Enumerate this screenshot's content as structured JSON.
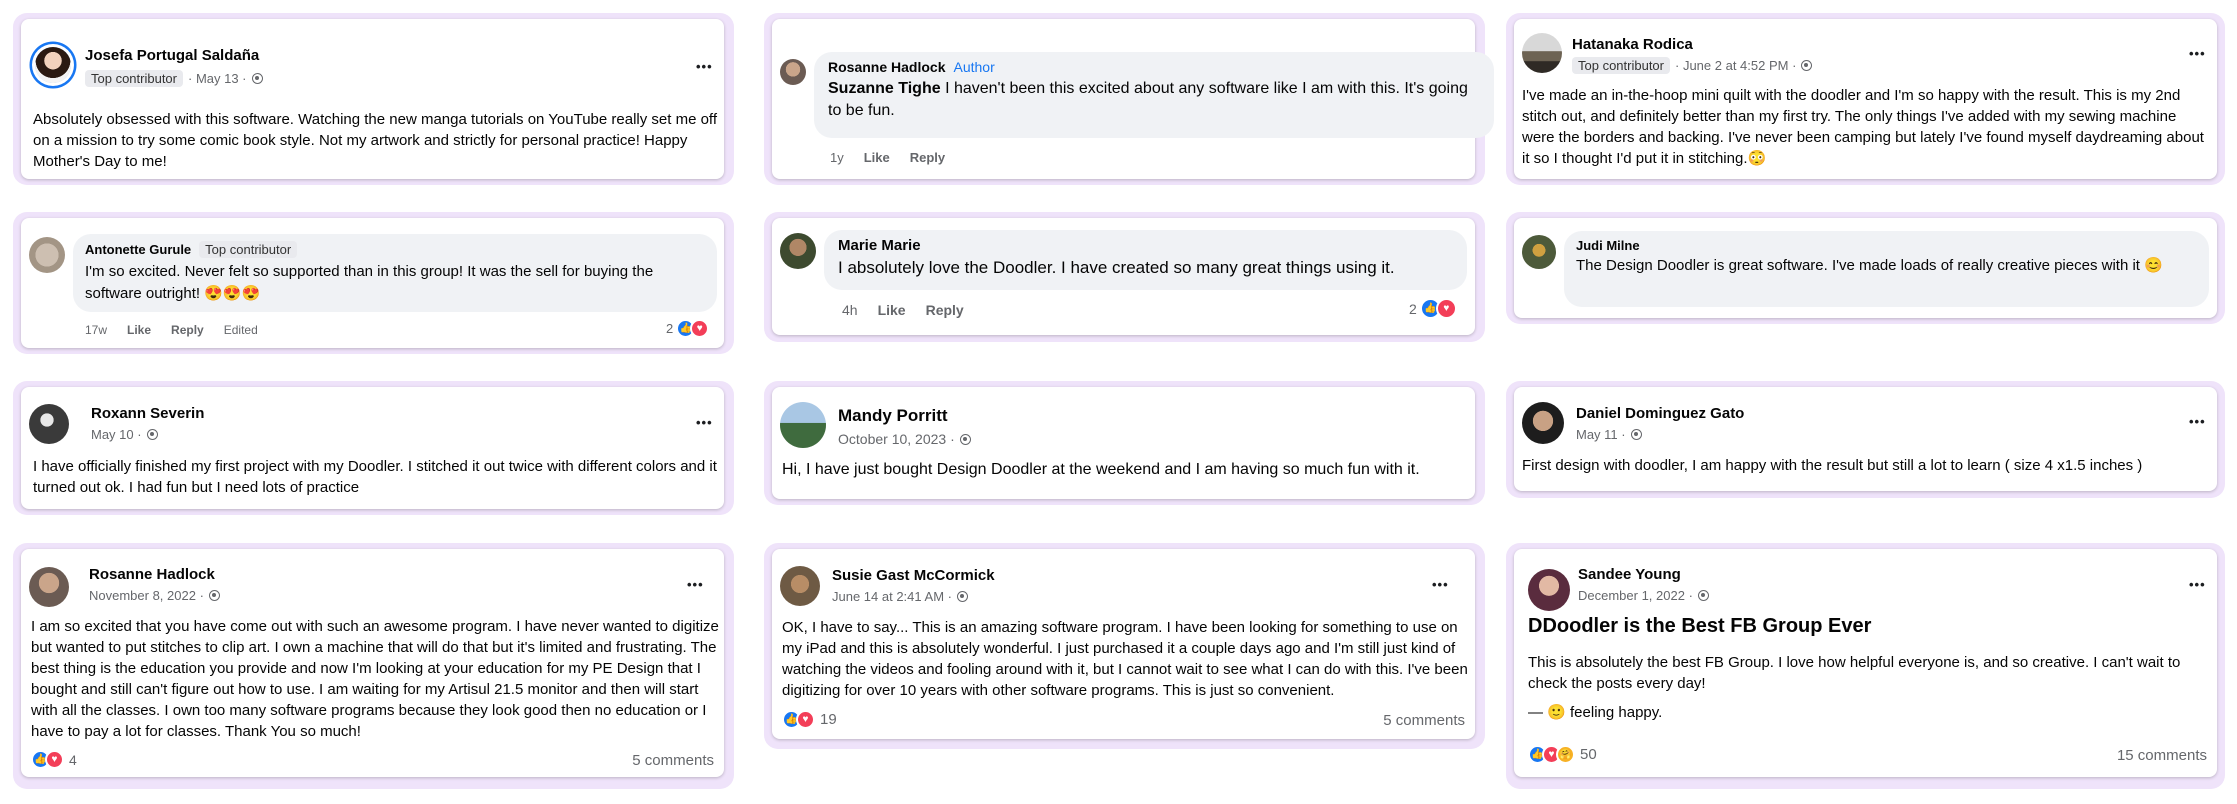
{
  "posts": {
    "p1": {
      "name": "Josefa Portugal Saldaña",
      "badge": "Top contributor",
      "date": "· May 13 ·",
      "more": "•••",
      "body": "Absolutely obsessed with this software. Watching the new manga tutorials on YouTube really set me off on a mission to try some comic book style. Not my artwork and strictly for personal practice! Happy Mother's Day to me!"
    },
    "p2": {
      "name": "Rosanne Hadlock",
      "author": "Author",
      "reply_name": "Suzanne Tighe",
      "text": "I haven't been this excited about any software like I am with this. It's going to be fun.",
      "time": "1y",
      "like": "Like",
      "reply": "Reply"
    },
    "p3": {
      "name": "Hatanaka Rodica",
      "badge": "Top contributor",
      "date": "· June 2 at 4:52 PM ·",
      "more": "•••",
      "body": "I've made an in-the-hoop mini quilt with the doodler and I'm so happy with the result. This is my 2nd stitch out, and definitely better than my first try. The only things I've added with my sewing machine were the borders and backing. I've never been camping but lately I've found myself daydreaming about it so I thought I'd put it in stitching.😳"
    },
    "p4": {
      "name": "Antonette Gurule",
      "badge": "Top contributor",
      "text": "I'm so excited. Never felt so supported than in this group! It was the sell for buying the software outright! 😍😍😍",
      "time": "17w",
      "like": "Like",
      "reply": "Reply",
      "edited": "Edited",
      "reactions": "2"
    },
    "p5": {
      "name": "Marie Marie",
      "text": "I absolutely love the Doodler. I have created so many great things using it.",
      "time": "4h",
      "like": "Like",
      "reply": "Reply",
      "reactions": "2"
    },
    "p6": {
      "name": "Judi Milne",
      "text": "The Design Doodler is great software. I've made loads of really creative pieces with it 😊"
    },
    "p7": {
      "name": "Roxann Severin",
      "date": "May 10 ·",
      "more": "•••",
      "body": "I have officially finished my first project with my Doodler.  I stitched it out twice with different colors and it turned out ok. I had fun but I need lots of practice"
    },
    "p8": {
      "name": "Mandy Porritt",
      "date": "October 10, 2023 ·",
      "body": "Hi, I have just bought Design Doodler at the weekend and I am having so much fun with it."
    },
    "p9": {
      "name": "Daniel Dominguez Gato",
      "date": "May 11 ·",
      "more": "•••",
      "body": "First design with doodler, I am happy with the result but still a lot to learn ( size 4 x1.5 inches )"
    },
    "p10": {
      "name": "Rosanne Hadlock",
      "date": "November 8, 2022 ·",
      "more": "•••",
      "body": "I am so excited that you have come out with such an awesome program. I have never wanted to digitize but wanted to put stitches to clip art. I own a machine that will do that but it's limited and frustrating. The best thing is the education you provide and now I'm looking at your education for my PE Design that I bought and still can't figure out how to use. I am waiting for my Artisul 21.5 monitor and then will start with all the classes. I own too many software programs because they look good then no education or I have to pay a lot for classes. Thank You so much!",
      "reactions": "4",
      "comments": "5 comments"
    },
    "p11": {
      "name": "Susie Gast McCormick",
      "date": "June 14 at 2:41 AM ·",
      "more": "•••",
      "body": "OK, I have to say... This is an amazing software program. I have been looking for something to use on my iPad and this is absolutely wonderful. I just purchased it a couple days ago and I'm still just kind of watching the videos and fooling around with it, but I cannot wait to see what I can do with this. I've been digitizing for over 10 years with other software programs. This is just so convenient.",
      "reactions": "19",
      "comments": "5 comments"
    },
    "p12": {
      "name": "Sandee Young",
      "date": "December 1, 2022 ·",
      "more": "•••",
      "headline": "DDoodler is the Best FB Group Ever",
      "body": "This is absolutely the best FB Group. I love how helpful everyone is, and so creative. I can't wait to check the posts every day!",
      "feeling": "— 🙂 feeling happy.",
      "reactions": "50",
      "comments": "15 comments"
    }
  },
  "colors": {
    "frame": "#efe3fa",
    "link": "#1877f2",
    "like": "#1877f2",
    "love": "#f33e58",
    "muted": "#65676b",
    "bubble": "#f0f2f5"
  },
  "icons": [
    "globe-icon",
    "more-icon",
    "like-reaction-icon",
    "love-reaction-icon",
    "care-reaction-icon"
  ]
}
